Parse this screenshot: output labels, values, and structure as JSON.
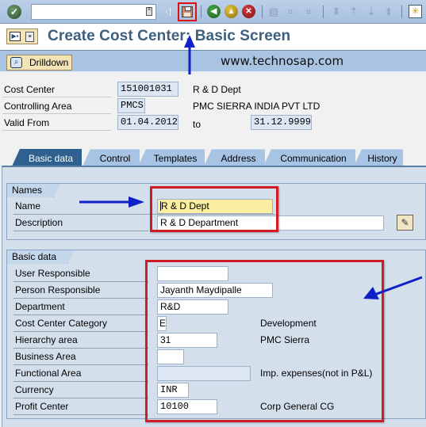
{
  "toolbar": {
    "command_field_value": "",
    "icons": [
      "enter-icon",
      "command-dropdown-icon",
      "collapse-arrow-icon",
      "save-icon",
      "back-icon",
      "exit-icon",
      "cancel-icon",
      "print-icon",
      "find-icon",
      "find-next-icon",
      "first-page-icon",
      "previous-page-icon",
      "next-page-icon",
      "last-page-icon",
      "customize-layout-icon"
    ]
  },
  "title": {
    "text": "Create Cost Center: Basic Screen"
  },
  "app_toolbar": {
    "drilldown_label": "Drilldown",
    "watermark": "www.technosap.com"
  },
  "header": {
    "cost_center": {
      "label": "Cost Center",
      "value": "151001031",
      "text": "R & D Dept"
    },
    "controlling_area": {
      "label": "Controlling Area",
      "value": "PMCS",
      "text": "PMC SIERRA INDIA PVT LTD"
    },
    "valid_from": {
      "label": "Valid From",
      "value": "01.04.2012",
      "to_label": "to",
      "to_value": "31.12.9999"
    }
  },
  "tabs": [
    {
      "label": "Basic data",
      "active": true
    },
    {
      "label": "Control",
      "active": false
    },
    {
      "label": "Templates",
      "active": false
    },
    {
      "label": "Address",
      "active": false
    },
    {
      "label": "Communication",
      "active": false
    },
    {
      "label": "History",
      "active": false
    }
  ],
  "names_group": {
    "title": "Names",
    "name": {
      "label": "Name",
      "value": "R & D Dept"
    },
    "description": {
      "label": "Description",
      "value": "R & D Department"
    }
  },
  "basic_group": {
    "title": "Basic data",
    "fields": [
      {
        "label": "User Responsible",
        "value": "",
        "text": ""
      },
      {
        "label": "Person Responsible",
        "value": "Jayanth Maydipalle",
        "text": ""
      },
      {
        "label": "Department",
        "value": "R&D",
        "text": ""
      },
      {
        "label": "Cost Center Category",
        "value": "E",
        "text": "Development"
      },
      {
        "label": "Hierarchy area",
        "value": "31",
        "text": "PMC Sierra"
      },
      {
        "label": "Business Area",
        "value": "",
        "text": ""
      },
      {
        "label": "Functional Area",
        "value": "",
        "text": "Imp. expenses(not in P&L)"
      },
      {
        "label": "Currency",
        "value": "INR",
        "text": ""
      },
      {
        "label": "Profit Center",
        "value": "10100",
        "text": "Corp General CG"
      }
    ]
  },
  "colors": {
    "annotation_red": "#d01c24",
    "annotation_blue": "#1020c8",
    "title_color": "#3e5f7e",
    "active_tab": "#2f6190"
  }
}
